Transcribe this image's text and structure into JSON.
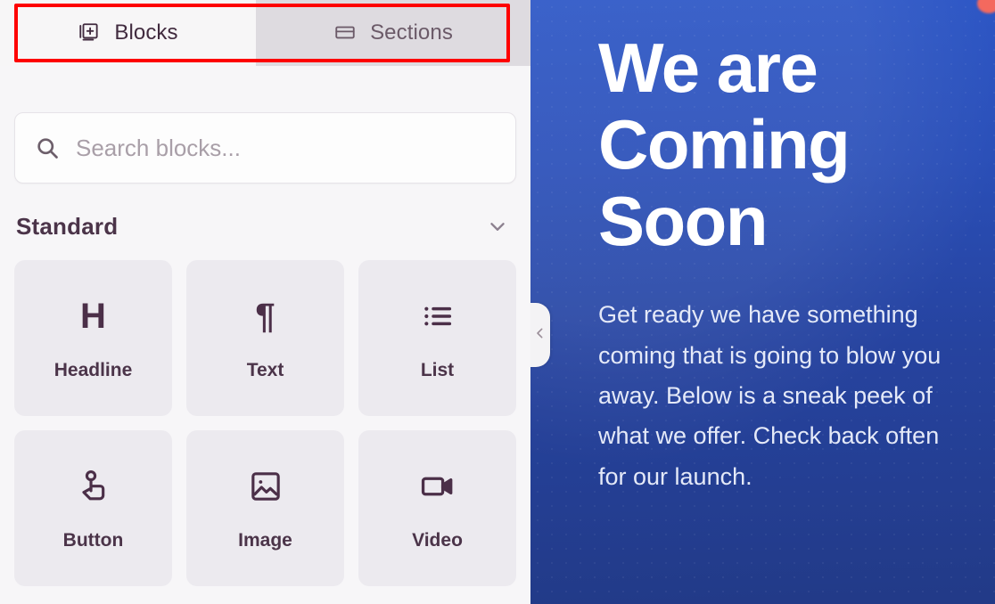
{
  "tabs": [
    {
      "id": "blocks",
      "label": "Blocks",
      "icon": "blocks-stack-plus-icon",
      "active": true
    },
    {
      "id": "sections",
      "label": "Sections",
      "icon": "sections-layout-icon",
      "active": false
    }
  ],
  "search": {
    "placeholder": "Search blocks...",
    "value": "",
    "icon": "search-icon"
  },
  "group": {
    "title": "Standard",
    "toggle_icon": "chevron-down-icon",
    "expanded": true
  },
  "blocks": [
    {
      "label": "Headline",
      "icon": "heading-h-icon",
      "glyph": "H"
    },
    {
      "label": "Text",
      "icon": "pilcrow-icon",
      "glyph": "¶"
    },
    {
      "label": "List",
      "icon": "bullet-list-icon",
      "glyph": ""
    },
    {
      "label": "Button",
      "icon": "tap-hand-icon",
      "glyph": ""
    },
    {
      "label": "Image",
      "icon": "image-icon",
      "glyph": ""
    },
    {
      "label": "Video",
      "icon": "video-camera-icon",
      "glyph": ""
    }
  ],
  "preview": {
    "headline": "We are Coming Soon",
    "body": "Get ready we have something coming that is going to blow you away. Below is a sneak peek of what we offer. Check back often for our launch.",
    "collapse_icon": "chevron-left-icon"
  },
  "annotation": {
    "type": "highlight-rectangle",
    "color": "#fe0000",
    "target": "tab-bar"
  },
  "colors": {
    "accent_blue_top": "#2c56c6",
    "accent_blue_bottom": "#223a87",
    "panel_bg": "#f7f6f8",
    "tile_bg": "#eceaef",
    "tab_active_bg": "#f7f6f7",
    "tab_inactive_bg": "#dedbe0",
    "icon_purple": "#4b2f48",
    "annotation_red": "#fe0000",
    "corner_marker": "#f4695e"
  }
}
